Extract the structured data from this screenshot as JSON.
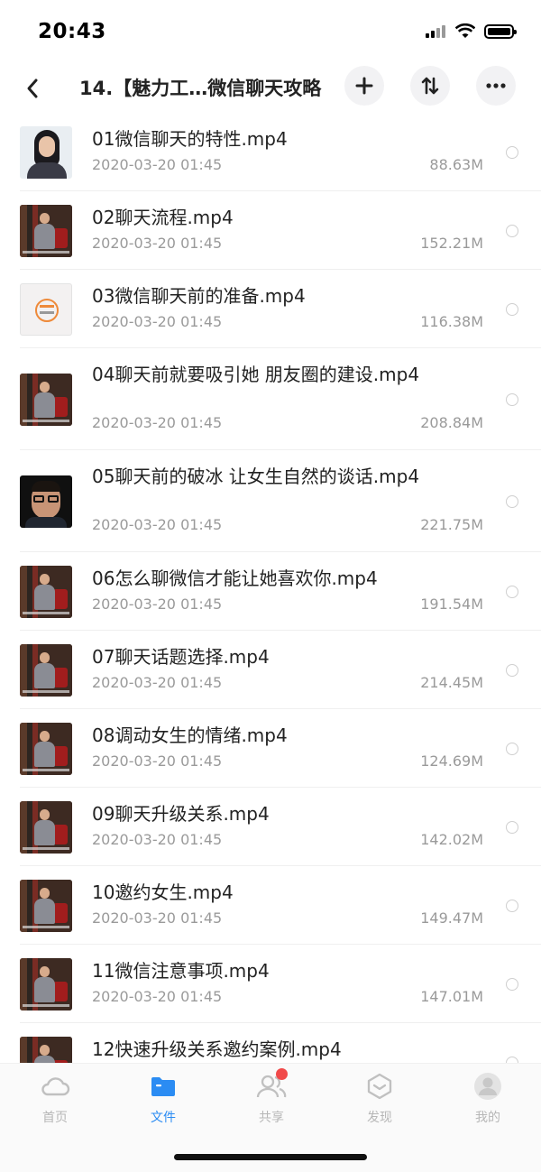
{
  "status_bar": {
    "time": "20:43"
  },
  "nav": {
    "title": "14.【魅力工…微信聊天攻略"
  },
  "files": [
    {
      "name": "01微信聊天的特性.mp4",
      "date": "2020-03-20 01:45",
      "size": "88.63M",
      "thumb": "portrait"
    },
    {
      "name": "02聊天流程.mp4",
      "date": "2020-03-20 01:45",
      "size": "152.21M",
      "thumb": "studio"
    },
    {
      "name": "03微信聊天前的准备.mp4",
      "date": "2020-03-20 01:45",
      "size": "116.38M",
      "thumb": "logo"
    },
    {
      "name": "04聊天前就要吸引她 朋友圈的建设.mp4",
      "date": "2020-03-20 01:45",
      "size": "208.84M",
      "thumb": "studio"
    },
    {
      "name": "05聊天前的破冰 让女生自然的谈话.mp4",
      "date": "2020-03-20 01:45",
      "size": "221.75M",
      "thumb": "glasses"
    },
    {
      "name": "06怎么聊微信才能让她喜欢你.mp4",
      "date": "2020-03-20 01:45",
      "size": "191.54M",
      "thumb": "studio"
    },
    {
      "name": "07聊天话题选择.mp4",
      "date": "2020-03-20 01:45",
      "size": "214.45M",
      "thumb": "studio"
    },
    {
      "name": "08调动女生的情绪.mp4",
      "date": "2020-03-20 01:45",
      "size": "124.69M",
      "thumb": "studio"
    },
    {
      "name": "09聊天升级关系.mp4",
      "date": "2020-03-20 01:45",
      "size": "142.02M",
      "thumb": "studio"
    },
    {
      "name": "10邀约女生.mp4",
      "date": "2020-03-20 01:45",
      "size": "149.47M",
      "thumb": "studio"
    },
    {
      "name": "11微信注意事项.mp4",
      "date": "2020-03-20 01:45",
      "size": "147.01M",
      "thumb": "studio"
    },
    {
      "name": "12快速升级关系邀约案例.mp4",
      "date": "",
      "size": "",
      "thumb": "studio"
    }
  ],
  "tabs": [
    {
      "label": "首页",
      "icon": "cloud-icon"
    },
    {
      "label": "文件",
      "icon": "folder-icon",
      "active": true
    },
    {
      "label": "共享",
      "icon": "people-icon",
      "badge": true
    },
    {
      "label": "发现",
      "icon": "discover-icon"
    },
    {
      "label": "我的",
      "icon": "avatar-icon"
    }
  ],
  "colors": {
    "accent": "#2b8cf3",
    "badge": "#f14a4a",
    "secondary_text": "#9a9a9a"
  }
}
